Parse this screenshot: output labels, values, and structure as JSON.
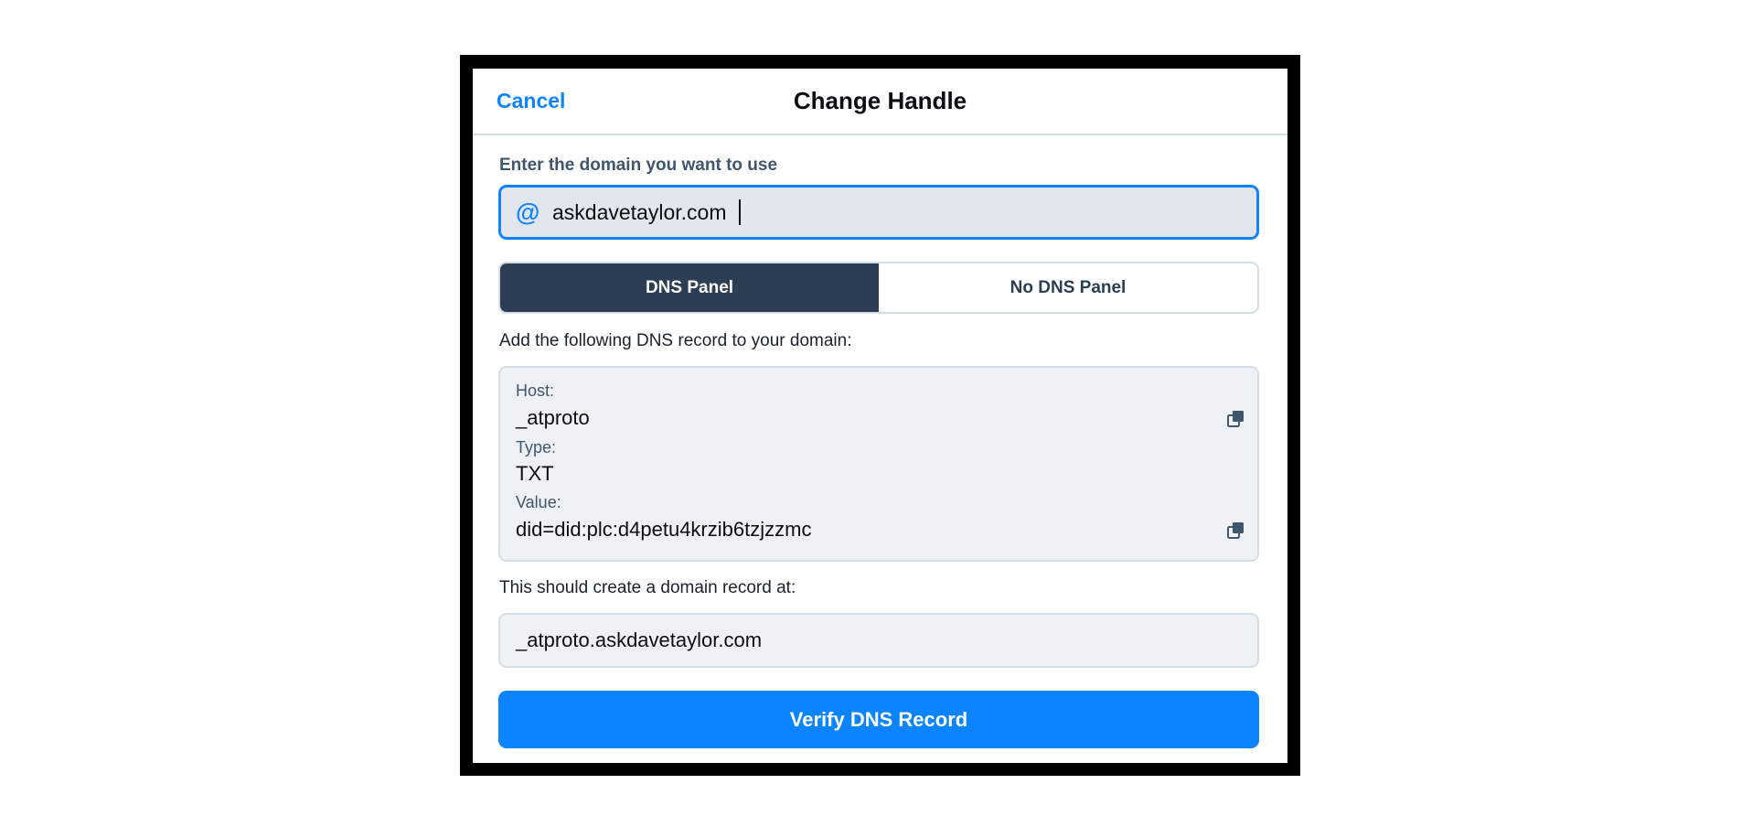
{
  "header": {
    "cancel_label": "Cancel",
    "title": "Change Handle"
  },
  "form": {
    "domain_label": "Enter the domain you want to use",
    "domain_prefix_icon": "at-sign-icon",
    "domain_value": "askdavetaylor.com"
  },
  "toggle": {
    "options": [
      {
        "label": "DNS Panel",
        "selected": true
      },
      {
        "label": "No DNS Panel",
        "selected": false
      }
    ]
  },
  "dns": {
    "instruction": "Add the following DNS record to your domain:",
    "host_label": "Host:",
    "host_value": "_atproto",
    "type_label": "Type:",
    "type_value": "TXT",
    "value_label": "Value:",
    "value_value": "did=did:plc:d4petu4krzib6tzjzzmc",
    "copy_icon": "copy-icon"
  },
  "result": {
    "label": "This should create a domain record at:",
    "value": "_atproto.askdavetaylor.com"
  },
  "actions": {
    "verify_label": "Verify DNS Record"
  },
  "colors": {
    "accent": "#1083fe",
    "primary_button": "#0a85ff",
    "selected_segment": "#2c3e54",
    "muted_text": "#40566d",
    "field_background": "#eef1f5",
    "border": "#d4dde6"
  }
}
